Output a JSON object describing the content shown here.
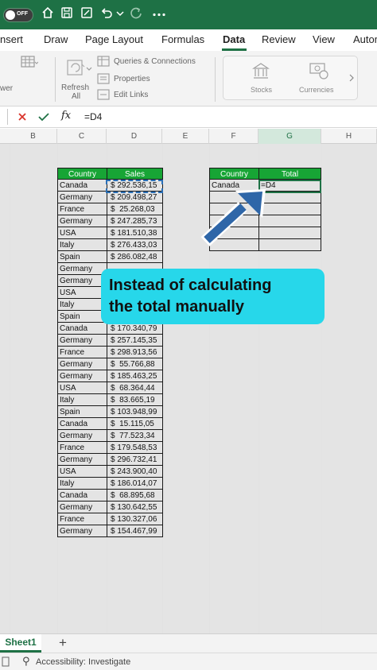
{
  "titlebar": {
    "autosave_label": "OFF",
    "icons": [
      "home-icon",
      "save-icon",
      "edit-icon",
      "undo-icon",
      "chevron-down-icon",
      "redo-icon",
      "more-icon"
    ]
  },
  "ribbon": {
    "tabs": [
      {
        "label": "nsert"
      },
      {
        "label": "Draw"
      },
      {
        "label": "Page Layout"
      },
      {
        "label": "Formulas"
      },
      {
        "label": "Data"
      },
      {
        "label": "Review"
      },
      {
        "label": "View"
      },
      {
        "label": "Autom"
      }
    ],
    "active_tab": "Data",
    "partial_left_label": "wer",
    "refresh_line1": "Refresh",
    "refresh_line2": "All",
    "queries_connections": "Queries & Connections",
    "properties": "Properties",
    "edit_links": "Edit Links",
    "stocks": "Stocks",
    "currencies": "Currencies"
  },
  "formula_bar": {
    "formula": "=D4"
  },
  "columns": [
    "B",
    "C",
    "D",
    "E",
    "F",
    "G",
    "H"
  ],
  "sales_table": {
    "headers": {
      "country": "Country",
      "sales": "Sales"
    },
    "rows": [
      {
        "country": "Canada",
        "sales": "$ 292.536,15"
      },
      {
        "country": "Germany",
        "sales": "$ 209.498,27"
      },
      {
        "country": "France",
        "sales": "$  25.268,03"
      },
      {
        "country": "Germany",
        "sales": "$ 247.285,73"
      },
      {
        "country": "USA",
        "sales": "$ 181.510,38"
      },
      {
        "country": "Italy",
        "sales": "$ 276.433,03"
      },
      {
        "country": "Spain",
        "sales": "$ 286.082,48"
      },
      {
        "country": "Germany",
        "sales": ""
      },
      {
        "country": "Germany",
        "sales": ""
      },
      {
        "country": "USA",
        "sales": ""
      },
      {
        "country": "Italy",
        "sales": ""
      },
      {
        "country": "Spain",
        "sales": ""
      },
      {
        "country": "Canada",
        "sales": "$ 170.340,79"
      },
      {
        "country": "Germany",
        "sales": "$ 257.145,35"
      },
      {
        "country": "France",
        "sales": "$ 298.913,56"
      },
      {
        "country": "Germany",
        "sales": "$  55.766,88"
      },
      {
        "country": "Germany",
        "sales": "$ 185.463,25"
      },
      {
        "country": "USA",
        "sales": "$  68.364,44"
      },
      {
        "country": "Italy",
        "sales": "$  83.665,19"
      },
      {
        "country": "Spain",
        "sales": "$ 103.948,99"
      },
      {
        "country": "Canada",
        "sales": "$  15.115,05"
      },
      {
        "country": "Germany",
        "sales": "$  77.523,34"
      },
      {
        "country": "France",
        "sales": "$ 179.548,53"
      },
      {
        "country": "Germany",
        "sales": "$ 296.732,41"
      },
      {
        "country": "USA",
        "sales": "$ 243.900,40"
      },
      {
        "country": "Italy",
        "sales": "$ 186.014,07"
      },
      {
        "country": "Canada",
        "sales": "$  68.895,68"
      },
      {
        "country": "Germany",
        "sales": "$ 130.642,55"
      },
      {
        "country": "France",
        "sales": "$ 130.327,06"
      },
      {
        "country": "Germany",
        "sales": "$ 154.467,99"
      }
    ]
  },
  "summary_table": {
    "headers": {
      "country": "Country",
      "total": "Total"
    },
    "rows": [
      {
        "country": "Canada",
        "total": "=D4"
      },
      {
        "country": "",
        "total": ""
      },
      {
        "country": "",
        "total": ""
      },
      {
        "country": "",
        "total": ""
      },
      {
        "country": "",
        "total": ""
      },
      {
        "country": "",
        "total": ""
      }
    ]
  },
  "annotation": {
    "line1": "Instead of calculating",
    "line2": "the total manually",
    "color": "#27d7ea",
    "arrow_color": "#2e66a8"
  },
  "sheets": {
    "active": "Sheet1",
    "add_label": "+"
  },
  "status": {
    "accessibility": "Accessibility: Investigate"
  },
  "colors": {
    "excel_green": "#1e7145",
    "header_green": "#17a535"
  }
}
